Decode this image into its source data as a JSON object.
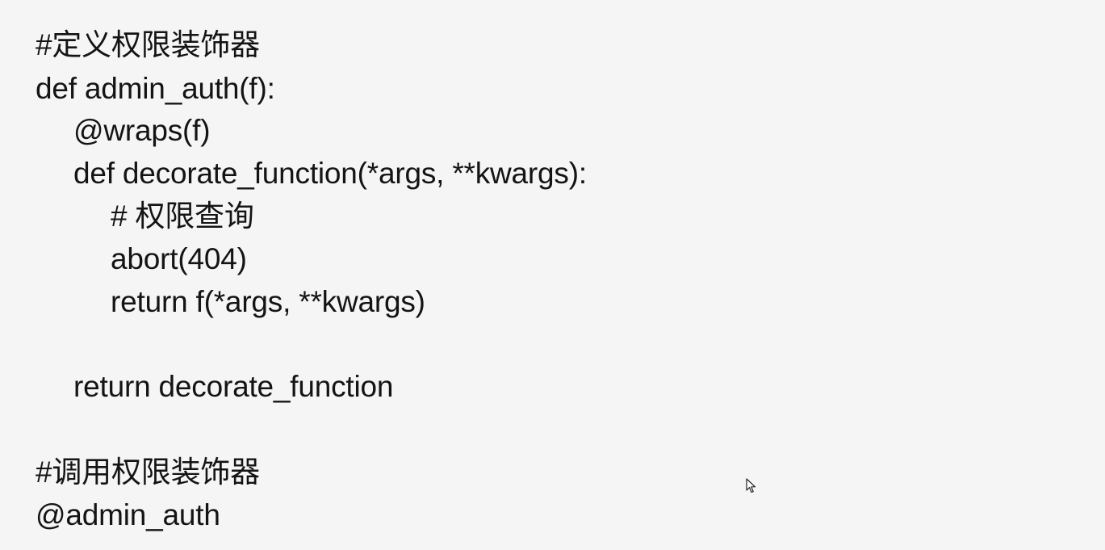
{
  "slide": {
    "lines": [
      "#定义权限装饰器",
      "def admin_auth(f):",
      "@wraps(f)",
      "def decorate_function(*args, **kwargs):",
      "# 权限查询",
      "abort(404)",
      "return f(*args, **kwargs)",
      "return decorate_function",
      "#调用权限装饰器",
      "@admin_auth"
    ]
  },
  "cursor": {
    "icon": "mouse-pointer-icon"
  }
}
